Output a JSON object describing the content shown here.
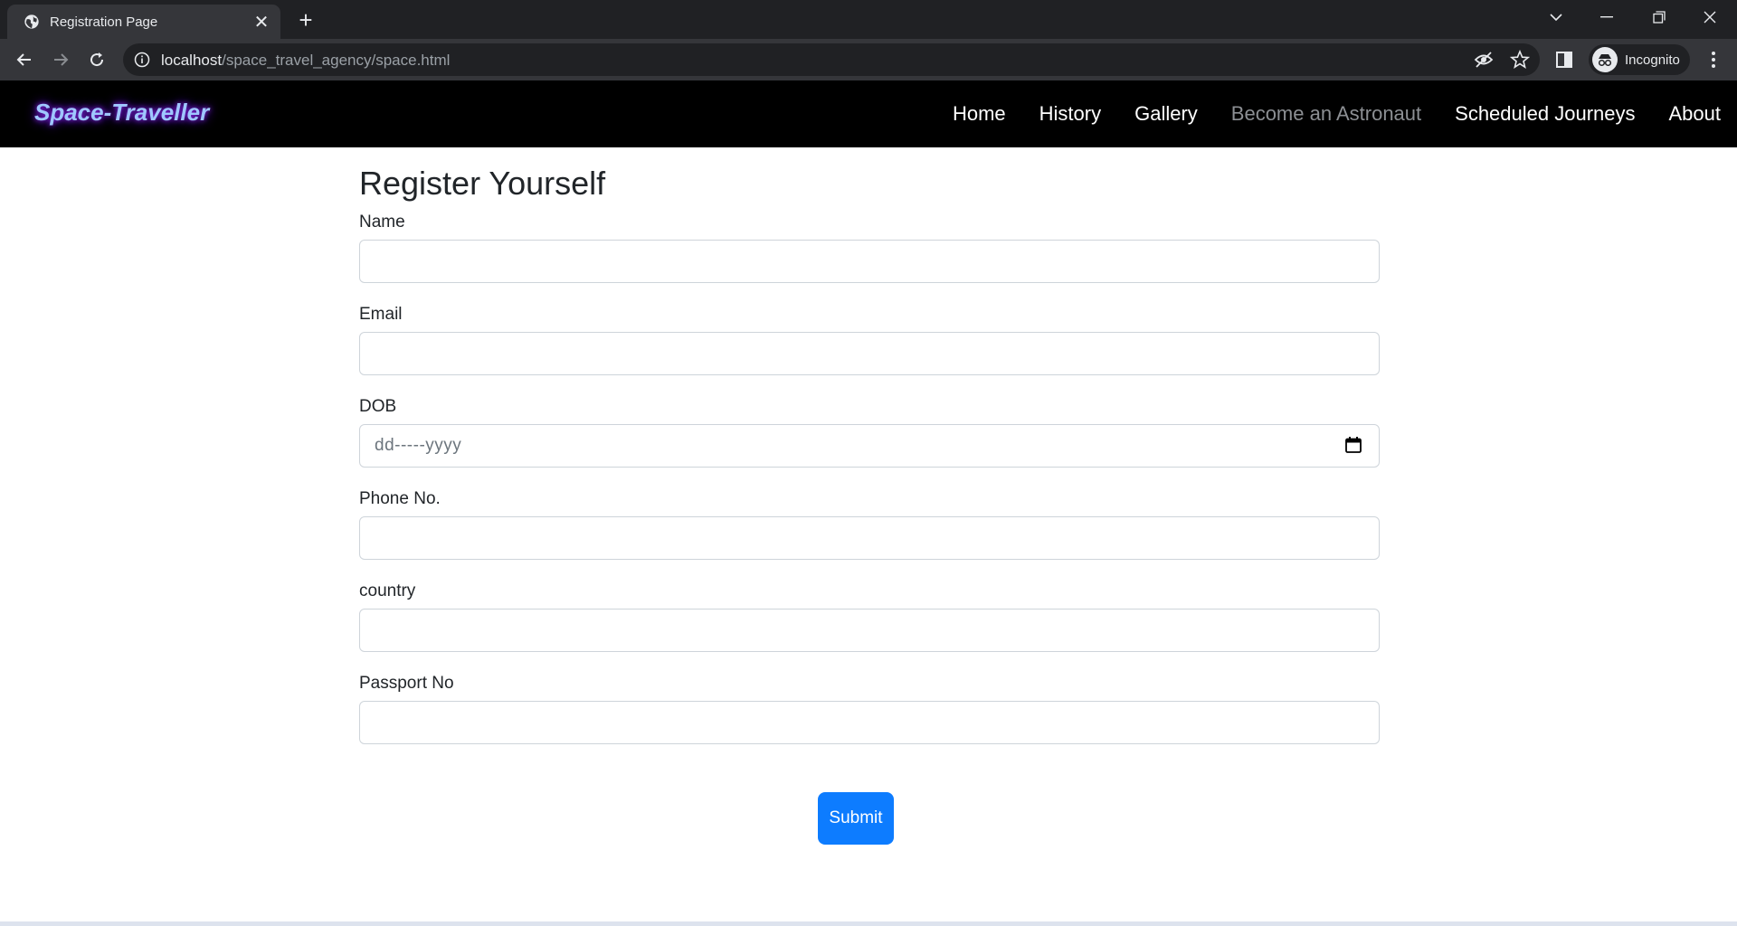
{
  "browser": {
    "tab_title": "Registration Page",
    "url_host": "localhost",
    "url_path": "/space_travel_agency/space.html",
    "profile_label": "Incognito"
  },
  "nav": {
    "brand": "Space-Traveller",
    "links": [
      {
        "label": "Home"
      },
      {
        "label": "History"
      },
      {
        "label": "Gallery"
      },
      {
        "label": "Become an Astronaut",
        "active": true
      },
      {
        "label": "Scheduled Journeys"
      },
      {
        "label": "About"
      }
    ]
  },
  "form": {
    "title": "Register Yourself",
    "fields": [
      {
        "label": "Name",
        "value": ""
      },
      {
        "label": "Email",
        "value": ""
      },
      {
        "label": "DOB",
        "placeholder": "dd-----yyyy"
      },
      {
        "label": "Phone No.",
        "value": ""
      },
      {
        "label": "country",
        "value": ""
      },
      {
        "label": "Passport No",
        "value": ""
      }
    ],
    "submit_label": "Submit"
  },
  "colors": {
    "primary_button": "#0d7cff",
    "navbar_bg": "#000000",
    "brand_text": "#9fc7ff",
    "brand_glow": "#8a2be2"
  }
}
